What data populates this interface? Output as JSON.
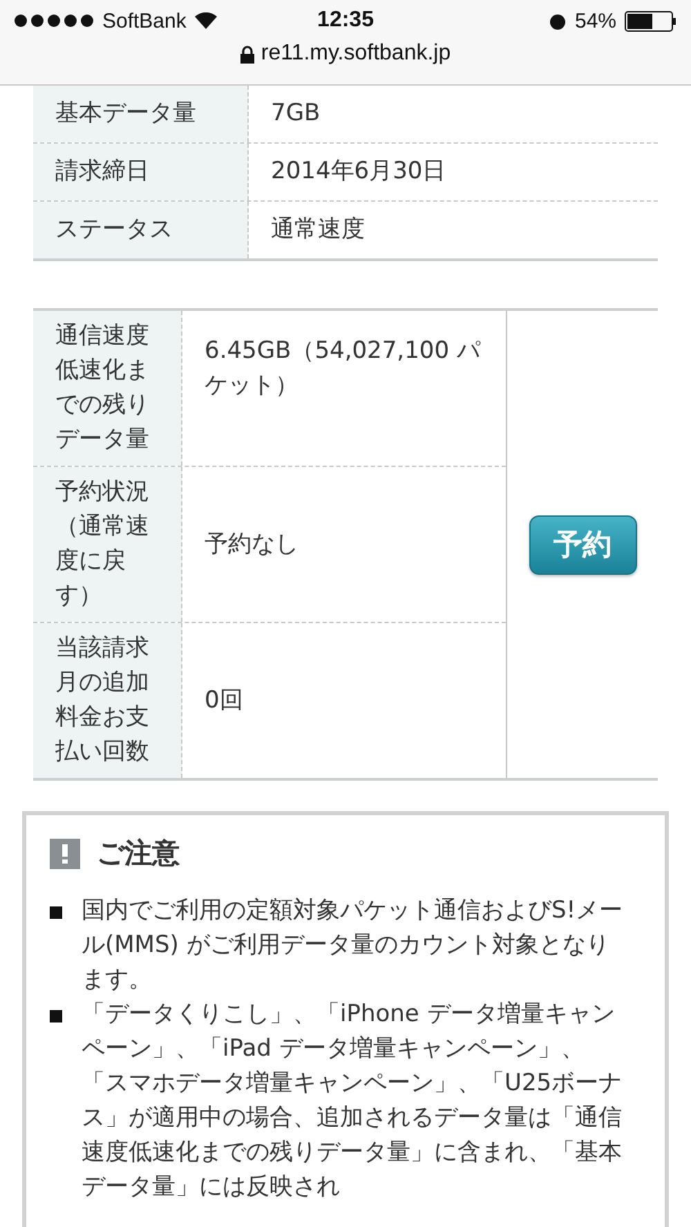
{
  "status_bar": {
    "carrier": "SoftBank",
    "time": "12:35",
    "battery": "54%",
    "url": "re11.my.softbank.jp"
  },
  "summary_table": {
    "rows": [
      {
        "label": "基本データ量",
        "value": "7GB"
      },
      {
        "label": "請求締日",
        "value": "2014年6月30日"
      },
      {
        "label": "ステータス",
        "value": "通常速度"
      }
    ]
  },
  "usage_table": {
    "rows": [
      {
        "label": "通信速度低速化までの残りデータ量",
        "value": "6.45GB（54,027,100 パケット）"
      },
      {
        "label": "予約状況（通常速度に戻す）",
        "value": "予約なし"
      },
      {
        "label": "当該請求月の追加料金お支払い回数",
        "value": "0回"
      }
    ],
    "button": "予約"
  },
  "notice": {
    "title": "ご注意",
    "items": [
      "国内でご利用の定額対象パケット通信およびS!メール(MMS) がご利用データ量のカウント対象となります。",
      "「データくりこし」、「iPhone データ増量キャンペーン」、「iPad データ増量キャンペーン」、「スマホデータ増量キャンペーン」、「U25ボーナス」が適用中の場合、追加されるデータ量は「通信速度低速化までの残りデータ量」に含まれ、「基本データ量」には反映され"
    ]
  }
}
